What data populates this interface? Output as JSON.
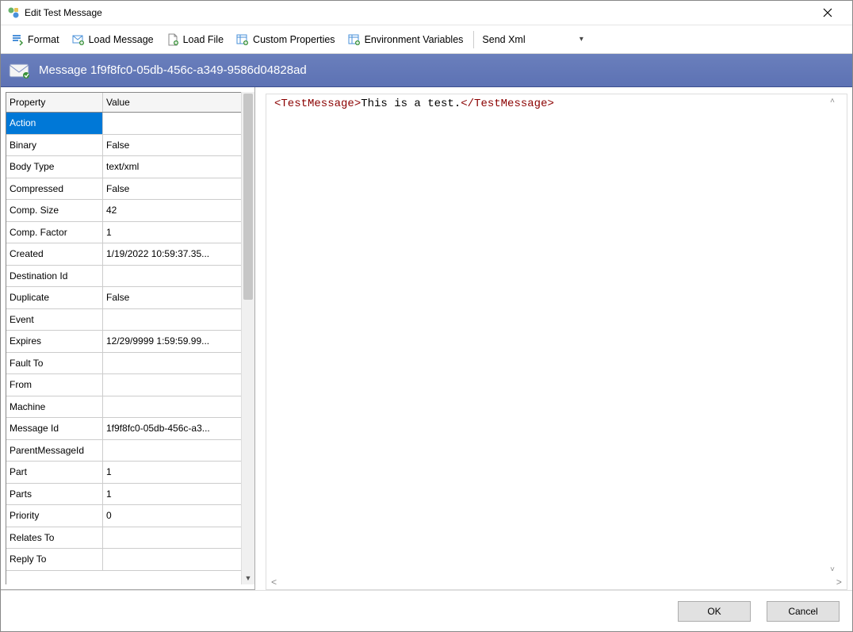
{
  "window": {
    "title": "Edit Test Message"
  },
  "toolbar": {
    "format": "Format",
    "load_message": "Load Message",
    "load_file": "Load File",
    "custom_properties": "Custom Properties",
    "env_vars": "Environment Variables",
    "send_xml": "Send Xml"
  },
  "bluebar": {
    "title": "Message 1f9f8fc0-05db-456c-a349-9586d04828ad"
  },
  "grid": {
    "header_property": "Property",
    "header_value": "Value",
    "rows": [
      {
        "p": "Action",
        "v": ""
      },
      {
        "p": "Binary",
        "v": "False"
      },
      {
        "p": "Body Type",
        "v": "text/xml"
      },
      {
        "p": "Compressed",
        "v": "False"
      },
      {
        "p": "Comp. Size",
        "v": "42"
      },
      {
        "p": "Comp. Factor",
        "v": "1"
      },
      {
        "p": "Created",
        "v": "1/19/2022 10:59:37.35..."
      },
      {
        "p": "Destination Id",
        "v": ""
      },
      {
        "p": "Duplicate",
        "v": "False"
      },
      {
        "p": "Event",
        "v": ""
      },
      {
        "p": "Expires",
        "v": "12/29/9999 1:59:59.99..."
      },
      {
        "p": "Fault To",
        "v": ""
      },
      {
        "p": "From",
        "v": ""
      },
      {
        "p": "Machine",
        "v": ""
      },
      {
        "p": "Message Id",
        "v": "1f9f8fc0-05db-456c-a3..."
      },
      {
        "p": "ParentMessageId",
        "v": ""
      },
      {
        "p": "Part",
        "v": "1"
      },
      {
        "p": "Parts",
        "v": "1"
      },
      {
        "p": "Priority",
        "v": "0"
      },
      {
        "p": "Relates To",
        "v": ""
      },
      {
        "p": "Reply To",
        "v": ""
      }
    ]
  },
  "editor": {
    "open_tag": "<TestMessage>",
    "text": "This is a test.",
    "close_tag": "</TestMessage>"
  },
  "footer": {
    "ok": "OK",
    "cancel": "Cancel"
  }
}
